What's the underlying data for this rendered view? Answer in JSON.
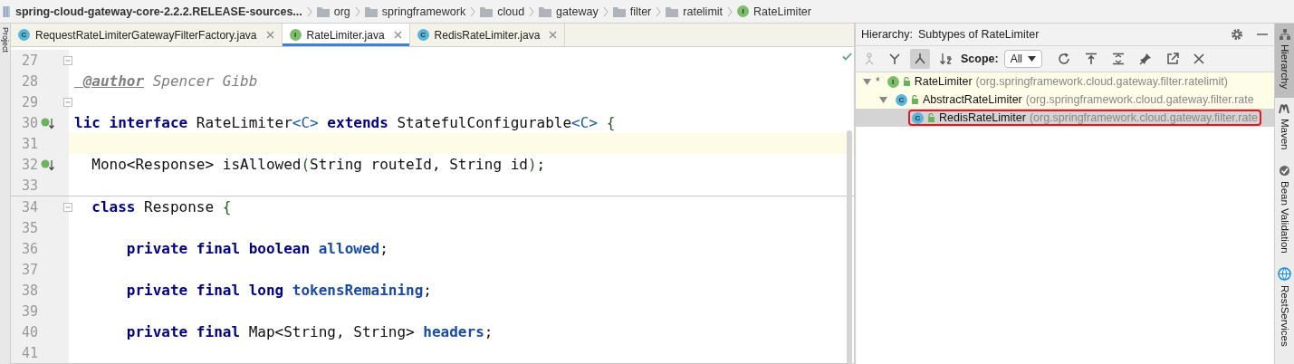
{
  "breadcrumbs": [
    {
      "kind": "project",
      "label": "spring-cloud-gateway-core-2.2.2.RELEASE-sources..."
    },
    {
      "kind": "folder",
      "label": "org"
    },
    {
      "kind": "folder",
      "label": "springframework"
    },
    {
      "kind": "folder",
      "label": "cloud"
    },
    {
      "kind": "folder",
      "label": "gateway"
    },
    {
      "kind": "folder",
      "label": "filter"
    },
    {
      "kind": "folder",
      "label": "ratelimit"
    },
    {
      "kind": "interface",
      "badge": "I",
      "label": "RateLimiter"
    }
  ],
  "left_strip": {
    "label": "Project"
  },
  "tabs": [
    {
      "kind": "class",
      "badge": "C",
      "label": "RequestRateLimiterGatewayFilterFactory.java",
      "selected": false
    },
    {
      "kind": "interface",
      "badge": "I",
      "label": "RateLimiter.java",
      "selected": true
    },
    {
      "kind": "class",
      "badge": "C",
      "label": "RedisRateLimiter.java",
      "selected": false
    }
  ],
  "editor": {
    "lines": [
      {
        "number": "27",
        "fold": true
      },
      {
        "number": "28",
        "tokens": [
          {
            "kind": "doc-tag",
            "text": " @author"
          },
          {
            "kind": "doc",
            "text": " Spencer Gibb"
          }
        ]
      },
      {
        "number": "29",
        "fold": true
      },
      {
        "number": "30",
        "implemented": true,
        "tokens": [
          {
            "kind": "keyword",
            "text": "lic interface"
          },
          {
            "kind": "plain",
            "text": " RateLimiter"
          },
          {
            "kind": "generic",
            "text": "<C>"
          },
          {
            "kind": "keyword",
            "text": " extends"
          },
          {
            "kind": "plain",
            "text": " StatefulConfigurable"
          },
          {
            "kind": "generic",
            "text": "<C>"
          },
          {
            "kind": "brace",
            "text": " {"
          }
        ]
      },
      {
        "number": "31",
        "current": true
      },
      {
        "number": "32",
        "implemented": true,
        "tokens": [
          {
            "kind": "plain",
            "text": "  Mono<Response> isAllowed"
          },
          {
            "kind": "paren",
            "text": "("
          },
          {
            "kind": "plain",
            "text": "String routeId, String id"
          },
          {
            "kind": "paren",
            "text": ")"
          },
          {
            "kind": "plain",
            "text": ";"
          }
        ]
      },
      {
        "number": "33"
      },
      {
        "number": "34",
        "fold": true,
        "separator": true,
        "tokens": [
          {
            "kind": "keyword",
            "text": "  class"
          },
          {
            "kind": "plain",
            "text": " Response "
          },
          {
            "kind": "brace",
            "text": "{"
          }
        ]
      },
      {
        "number": "35"
      },
      {
        "number": "36",
        "tokens": [
          {
            "kind": "keyword",
            "text": "      private final boolean"
          },
          {
            "kind": "field",
            "text": " allowed"
          },
          {
            "kind": "plain",
            "text": ";"
          }
        ]
      },
      {
        "number": "37"
      },
      {
        "number": "38",
        "tokens": [
          {
            "kind": "keyword",
            "text": "      private final long"
          },
          {
            "kind": "field",
            "text": " tokensRemaining"
          },
          {
            "kind": "plain",
            "text": ";"
          }
        ]
      },
      {
        "number": "39"
      },
      {
        "number": "40",
        "tokens": [
          {
            "kind": "keyword",
            "text": "      private final"
          },
          {
            "kind": "plain",
            "text": " Map<String, String> "
          },
          {
            "kind": "field",
            "text": "headers"
          },
          {
            "kind": "plain",
            "text": ";"
          }
        ]
      },
      {
        "number": "41",
        "separator_below": true
      }
    ]
  },
  "hierarchy": {
    "label": "Hierarchy:",
    "title": "Subtypes of RateLimiter",
    "toolbar": [
      {
        "kind": "supertypes",
        "selected": false,
        "disabled": true
      },
      {
        "kind": "type",
        "selected": false,
        "disabled": false
      },
      {
        "kind": "subtypes",
        "selected": true,
        "disabled": false
      },
      {
        "kind": "sort",
        "selected": false,
        "disabled": false
      }
    ],
    "scope": {
      "label": "Scope:",
      "value": "All"
    },
    "tree": [
      {
        "marker": "*",
        "kind": "interface",
        "badge": "I",
        "name": "RateLimiter",
        "package": "(org.springframework.cloud.gateway.filter.ratelimit)",
        "expanded": true,
        "selected": false,
        "outlined": false,
        "children": [
          {
            "kind": "class",
            "badge": "C",
            "name": "AbstractRateLimiter",
            "package": "(org.springframework.cloud.gateway.filter.rate",
            "expanded": true,
            "selected": false,
            "outlined": false,
            "children": [
              {
                "kind": "class",
                "badge": "C",
                "name": "RedisRateLimiter",
                "package": "(org.springframework.cloud.gateway.filter.rate",
                "selected": true,
                "outlined": true
              }
            ]
          }
        ]
      }
    ]
  },
  "right_strip": [
    {
      "kind": "hierarchy",
      "label": "Hierarchy",
      "selected": true
    },
    {
      "kind": "maven",
      "label": "Maven",
      "selected": false
    },
    {
      "kind": "bean",
      "label": "Bean Validation",
      "selected": false
    },
    {
      "kind": "rest",
      "label": "RestServices",
      "selected": false
    }
  ]
}
